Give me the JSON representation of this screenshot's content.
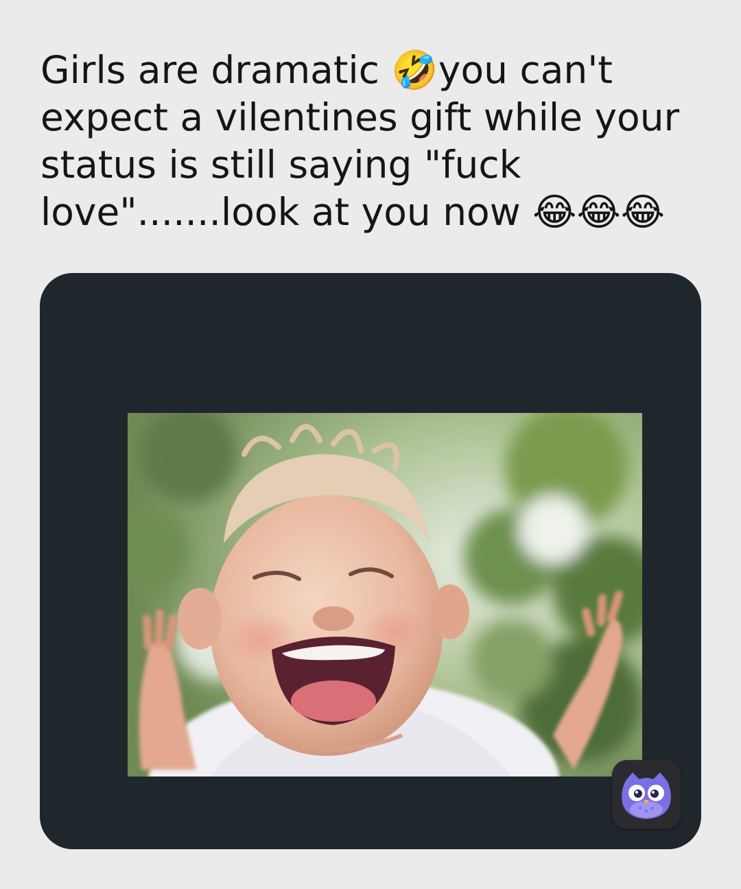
{
  "post": {
    "caption_lines": [
      "Girls are dramatic 🤣you can't",
      "expect a vilentines gift while your",
      "status is still saying \"fuck",
      "love\".......look at you now 😂😂😂"
    ]
  },
  "media": {
    "icon": "owl-app-icon",
    "colors": {
      "page_background": "#ebebeb",
      "card_background": "#1f272d",
      "badge_owl": "#7a6fe3"
    }
  }
}
